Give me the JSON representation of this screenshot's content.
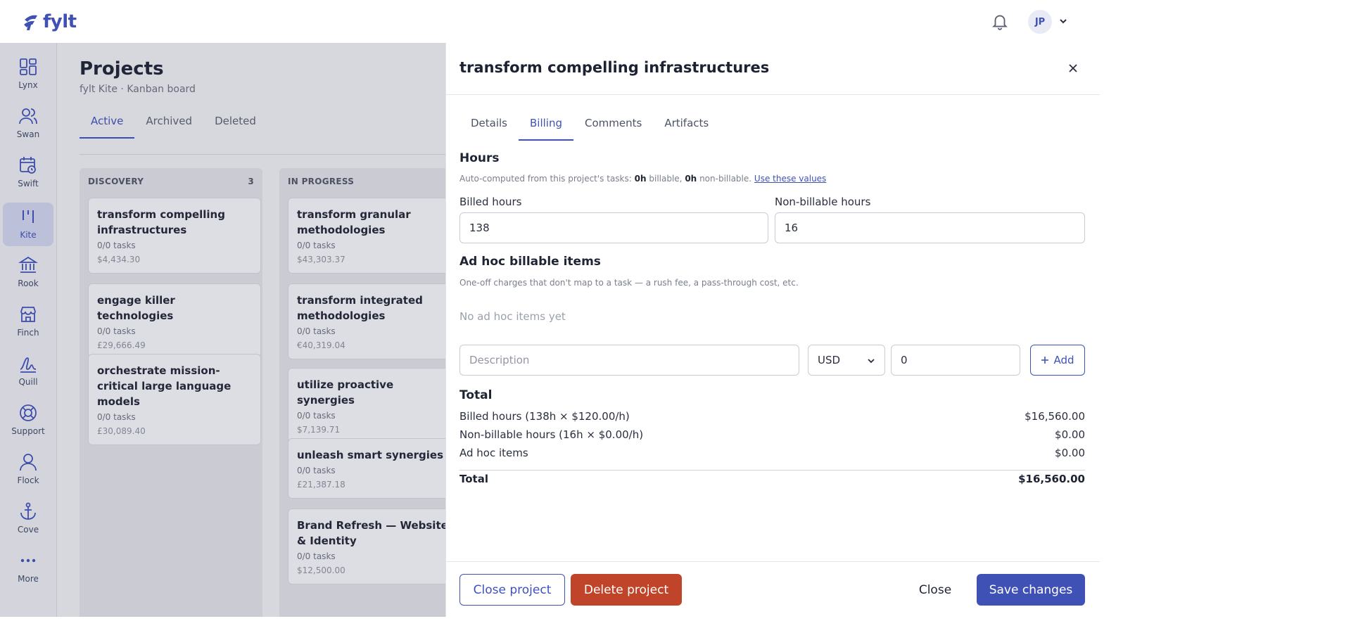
{
  "app": {
    "logo_text": "fylt",
    "user_initials": "JP"
  },
  "sidebar": {
    "items": [
      {
        "label": "Lynx",
        "icon": "grid-icon"
      },
      {
        "label": "Swan",
        "icon": "users-icon"
      },
      {
        "label": "Swift",
        "icon": "calendar-clock-icon"
      },
      {
        "label": "Kite",
        "icon": "kanban-icon",
        "active": true
      },
      {
        "label": "Rook",
        "icon": "bank-icon"
      },
      {
        "label": "Finch",
        "icon": "store-icon"
      },
      {
        "label": "Quill",
        "icon": "signature-icon"
      },
      {
        "label": "Support",
        "icon": "lifebuoy-icon"
      },
      {
        "label": "Flock",
        "icon": "user-group-icon"
      },
      {
        "label": "Cove",
        "icon": "anchor-icon"
      },
      {
        "label": "More",
        "icon": "more-icon"
      }
    ]
  },
  "page": {
    "title": "Projects",
    "subtitle": "fylt Kite · Kanban board",
    "tabs": [
      "Active",
      "Archived",
      "Deleted"
    ],
    "active_tab": "Active"
  },
  "board": {
    "columns": [
      {
        "name": "DISCOVERY",
        "count": "3",
        "cards": [
          {
            "title": "transform compelling infrastructures",
            "tasks": "0/0 tasks",
            "amount": "$4,434.30"
          },
          {
            "title": "engage killer technologies",
            "tasks": "0/0 tasks",
            "amount": "£29,666.49"
          },
          {
            "title": "orchestrate mission-critical large language models",
            "tasks": "0/0 tasks",
            "amount": "£30,089.40"
          }
        ]
      },
      {
        "name": "IN PROGRESS",
        "count": "",
        "cards": [
          {
            "title": "transform granular methodologies",
            "tasks": "0/0 tasks",
            "amount": "$43,303.37"
          },
          {
            "title": "transform integrated methodologies",
            "tasks": "0/0 tasks",
            "amount": "€40,319.04"
          },
          {
            "title": "utilize proactive synergies",
            "tasks": "0/0 tasks",
            "amount": "$7,139.71"
          },
          {
            "title": "unleash smart synergies",
            "tasks": "0/0 tasks",
            "amount": "£21,387.18"
          },
          {
            "title": "Brand Refresh — Website & Identity",
            "tasks": "0/0 tasks",
            "amount": "$12,500.00"
          }
        ]
      }
    ]
  },
  "drawer": {
    "title": "transform compelling infrastructures",
    "tabs": [
      "Details",
      "Billing",
      "Comments",
      "Artifacts"
    ],
    "active_tab": "Billing",
    "hours": {
      "heading": "Hours",
      "hint_prefix": "Auto-computed from this project's tasks:",
      "billable_value": "0h",
      "billable_word": "billable,",
      "nonbillable_value": "0h",
      "nonbillable_word": "non-billable.",
      "use_link": "Use these values",
      "billed_label": "Billed hours",
      "billed_value": "138",
      "nonbillable_label": "Non-billable hours",
      "nonbillable_value_input": "16"
    },
    "adhoc": {
      "heading": "Ad hoc billable items",
      "hint": "One-off charges that don't map to a task — a rush fee, a pass-through cost, etc.",
      "empty": "No ad hoc items yet",
      "description_placeholder": "Description",
      "currency": "USD",
      "amount_value": "0",
      "add_label": "Add"
    },
    "total": {
      "heading": "Total",
      "rows": [
        {
          "label": "Billed hours (138h × $120.00/h)",
          "value": "$16,560.00"
        },
        {
          "label": "Non-billable hours (16h × $0.00/h)",
          "value": "$0.00"
        },
        {
          "label": "Ad hoc items",
          "value": "$0.00"
        }
      ],
      "final_label": "Total",
      "final_value": "$16,560.00"
    },
    "footer": {
      "close_project": "Close project",
      "delete_project": "Delete project",
      "close": "Close",
      "save": "Save changes"
    }
  },
  "colors": {
    "accent": "#3f51b5",
    "danger": "#c0442a"
  }
}
